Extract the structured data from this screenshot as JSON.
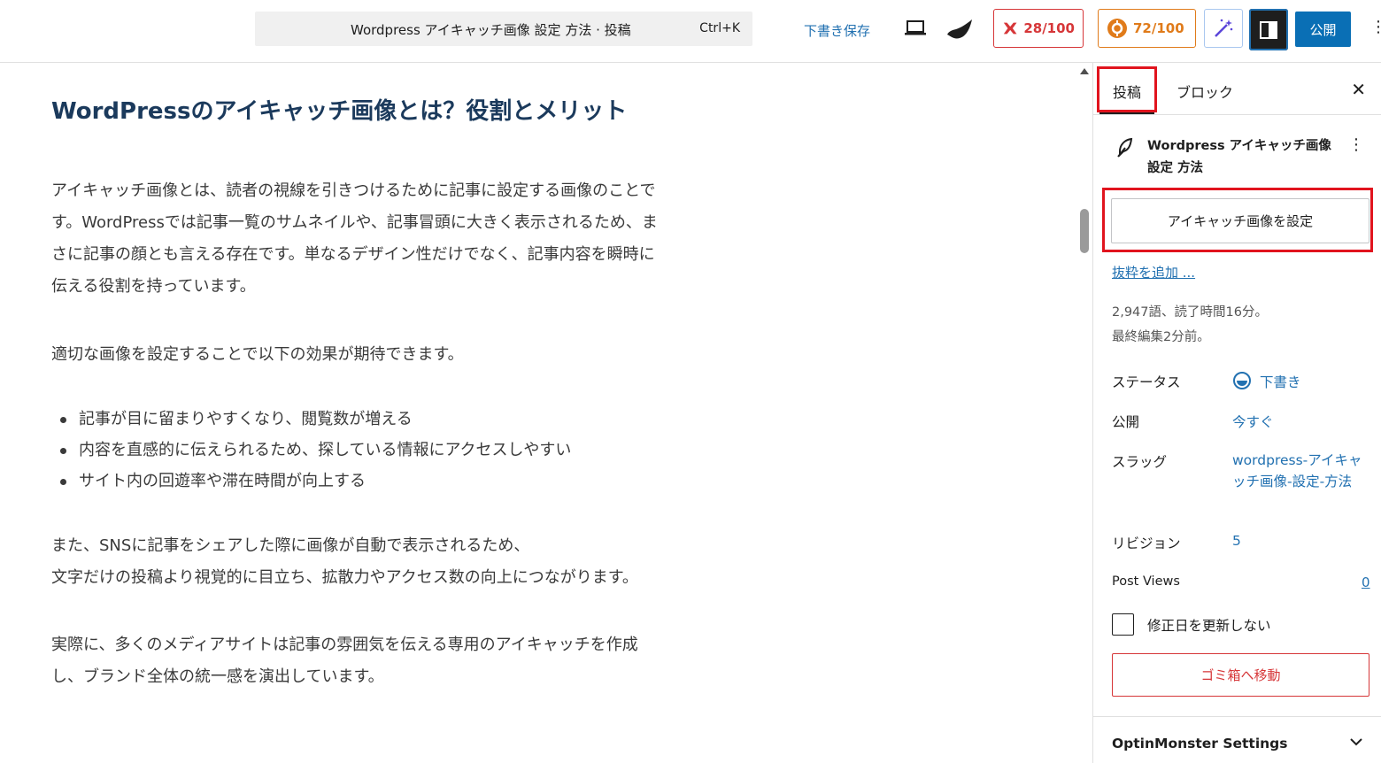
{
  "topbar": {
    "command_title": "Wordpress アイキャッチ画像 設定 方法 · 投稿",
    "command_shortcut": "Ctrl+K",
    "save_draft": "下書き保存",
    "score_red": "28/100",
    "score_orange": "72/100",
    "publish": "公開",
    "icons": [
      "laptop-icon",
      "brush-icon",
      "score-m-icon",
      "score-gear-icon",
      "magic-wand-icon",
      "sidebar-panel-icon",
      "more-vertical-icon"
    ]
  },
  "editor": {
    "heading": "WordPressのアイキャッチ画像とは？役割とメリット",
    "para1": [
      "アイキャッチ画像とは、読者の視線を引きつけるために記事に設定する画像のことで",
      "す。WordPressでは記事一覧のサムネイルや、記事冒頭に大きく表示されるため、ま",
      "さに記事の顔とも言える存在です。単なるデザイン性だけでなく、記事内容を瞬時に",
      "伝える役割を持っています。"
    ],
    "para2": "適切な画像を設定することで以下の効果が期待できます。",
    "bullets": [
      "記事が目に留まりやすくなり、閲覧数が増える",
      "内容を直感的に伝えられるため、探している情報にアクセスしやすい",
      "サイト内の回遊率や滞在時間が向上する"
    ],
    "para3": [
      "また、SNSに記事をシェアした際に画像が自動で表示されるため、",
      "文字だけの投稿より視覚的に目立ち、拡散力やアクセス数の向上につながります。"
    ],
    "para4": [
      "実際に、多くのメディアサイトは記事の雰囲気を伝える専用のアイキャッチを作成",
      "し、ブランド全体の統一感を演出しています。"
    ]
  },
  "sidebar": {
    "tab_post": "投稿",
    "tab_block": "ブロック",
    "post_title": "Wordpress アイキャッチ画像 設定 方法",
    "featured_button": "アイキャッチ画像を設定",
    "add_excerpt": "抜粋を追加 ...",
    "word_count": "2,947語、読了時間16分。",
    "last_edited": "最終編集2分前。",
    "status_label": "ステータス",
    "status_value": "下書き",
    "publish_label": "公開",
    "publish_value": "今すぐ",
    "slug_label": "スラッグ",
    "slug_value": "wordpress-アイキャッチ画像-設定-方法",
    "revision_label": "リビジョン",
    "revision_value": "5",
    "post_views_label": "Post Views",
    "post_views_value": "0",
    "no_update_modified": "修正日を更新しない",
    "trash_button": "ゴミ箱へ移動",
    "optinmonster": "OptinMonster Settings"
  }
}
